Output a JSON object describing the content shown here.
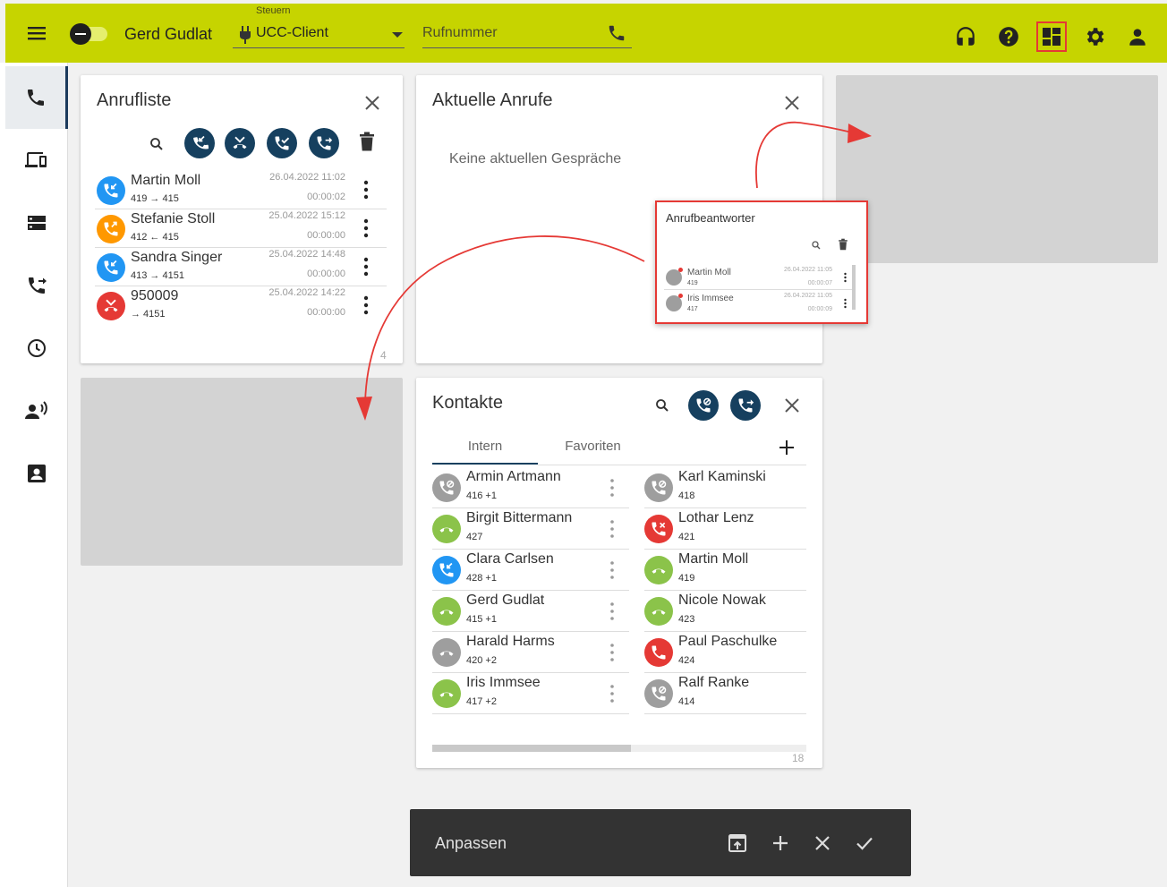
{
  "header": {
    "user_name": "Gerd Gudlat",
    "control_label": "Steuern",
    "client_select_value": "UCC-Client",
    "phone_placeholder": "Rufnummer"
  },
  "sidebar": {
    "items": [
      {
        "icon": "phone-icon",
        "active": true
      },
      {
        "icon": "devices-icon",
        "active": false
      },
      {
        "icon": "storage-icon",
        "active": false
      },
      {
        "icon": "call-forward-icon",
        "active": false
      },
      {
        "icon": "clock-icon",
        "active": false
      },
      {
        "icon": "person-voice-icon",
        "active": false
      },
      {
        "icon": "contact-card-icon",
        "active": false
      }
    ]
  },
  "call_list": {
    "title": "Anrufliste",
    "count": "4",
    "rows": [
      {
        "name": "Martin Moll",
        "route": "419 → 415",
        "date": "26.04.2022 11:02",
        "duration": "00:00:02",
        "type": "incoming",
        "color": "#2196f3"
      },
      {
        "name": "Stefanie Stoll",
        "route": "412 ← 415",
        "date": "25.04.2022 15:12",
        "duration": "00:00:00",
        "type": "outgoing",
        "color": "#ff9800"
      },
      {
        "name": "Sandra Singer",
        "route": "413 → 4151",
        "date": "25.04.2022 14:48",
        "duration": "00:00:00",
        "type": "incoming",
        "color": "#2196f3"
      },
      {
        "name": "950009",
        "route": "→ 4151",
        "date": "25.04.2022 14:22",
        "duration": "00:00:00",
        "type": "missed",
        "color": "#e53935"
      }
    ]
  },
  "current_calls": {
    "title": "Aktuelle Anrufe",
    "empty_text": "Keine aktuellen Gespräche"
  },
  "voicemail_popup": {
    "title": "Anrufbeantworter",
    "rows": [
      {
        "name": "Martin Moll",
        "number": "419",
        "date": "26.04.2022 11:05",
        "duration": "00:00:07"
      },
      {
        "name": "Iris Immsee",
        "number": "417",
        "date": "26.04.2022 11:05",
        "duration": "00:00:09"
      }
    ]
  },
  "contacts": {
    "title": "Kontakte",
    "tabs": [
      "Intern",
      "Favoriten"
    ],
    "active_tab": "Intern",
    "count": "18",
    "scroll_position": 0.53,
    "left": [
      {
        "name": "Armin Artmann",
        "ext": "416 +1",
        "color": "#9e9e9e",
        "icon": "dnd"
      },
      {
        "name": "Birgit Bittermann",
        "ext": "427",
        "color": "#8bc34a",
        "icon": "idle"
      },
      {
        "name": "Clara Carlsen",
        "ext": "428 +1",
        "color": "#2196f3",
        "icon": "incoming"
      },
      {
        "name": "Gerd Gudlat",
        "ext": "415 +1",
        "color": "#8bc34a",
        "icon": "idle"
      },
      {
        "name": "Harald Harms",
        "ext": "420 +2",
        "color": "#9e9e9e",
        "icon": "idle"
      },
      {
        "name": "Iris Immsee",
        "ext": "417 +2",
        "color": "#8bc34a",
        "icon": "idle"
      }
    ],
    "right": [
      {
        "name": "Karl Kaminski",
        "ext": "418",
        "color": "#9e9e9e",
        "icon": "dnd"
      },
      {
        "name": "Lothar Lenz",
        "ext": "421",
        "color": "#e53935",
        "icon": "blocked"
      },
      {
        "name": "Martin Moll",
        "ext": "419",
        "color": "#8bc34a",
        "icon": "idle"
      },
      {
        "name": "Nicole Nowak",
        "ext": "423",
        "color": "#8bc34a",
        "icon": "idle"
      },
      {
        "name": "Paul Paschulke",
        "ext": "424",
        "color": "#e53935",
        "icon": "busy"
      },
      {
        "name": "Ralf Ranke",
        "ext": "414",
        "color": "#9e9e9e",
        "icon": "dnd"
      }
    ]
  },
  "customize_bar": {
    "label": "Anpassen"
  },
  "colors": {
    "topbar": "#c6d400",
    "accent_dark": "#16405f",
    "highlight_red": "#e53935"
  }
}
